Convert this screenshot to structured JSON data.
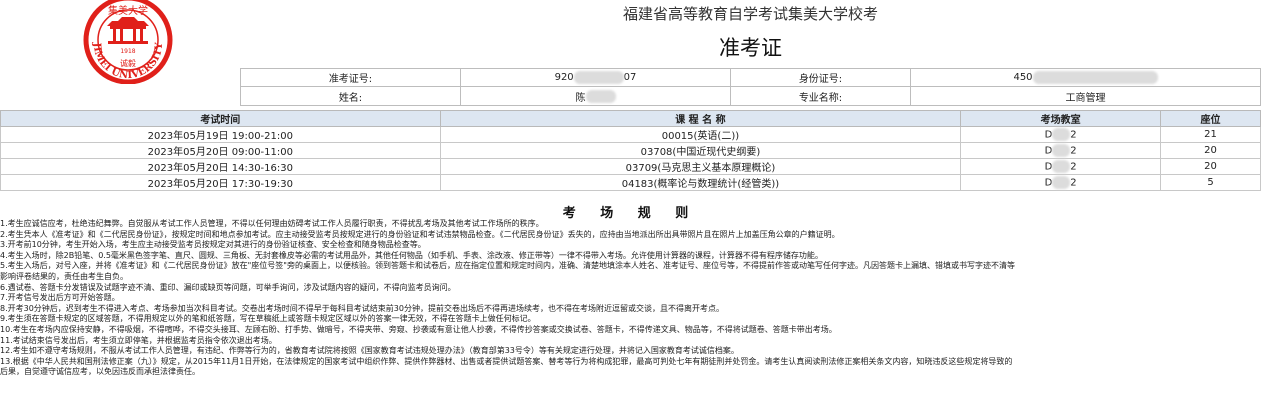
{
  "header": {
    "title": "福建省高等教育自学考试集美大学校考",
    "subtitle": "准考证"
  },
  "logo": {
    "arc_text": "JIMEI UNIVERSITY",
    "year": "1918",
    "seal_chars": "诚毅",
    "top_chars": "集美大学",
    "color": "#e0201a"
  },
  "info": {
    "ticket_label": "准考证号:",
    "ticket_start": "920",
    "ticket_end": "07",
    "id_label": "身份证号:",
    "id_start": "450",
    "name_label": "姓名:",
    "name_start": "陈",
    "major_label": "专业名称:",
    "major_value": "工商管理"
  },
  "exam_table": {
    "headers": [
      "考试时间",
      "课 程 名 称",
      "考场教室",
      "座位"
    ],
    "rows": [
      {
        "time": "2023年05月19日 19:00-21:00",
        "course": "00015(英语(二))",
        "room_start": "D",
        "room_end": "2",
        "seat": "21"
      },
      {
        "time": "2023年05月20日 09:00-11:00",
        "course": "03708(中国近现代史纲要)",
        "room_start": "D",
        "room_end": "2",
        "seat": "20"
      },
      {
        "time": "2023年05月20日 14:30-16:30",
        "course": "03709(马克思主义基本原理概论)",
        "room_start": "D",
        "room_end": "2",
        "seat": "20"
      },
      {
        "time": "2023年05月20日 17:30-19:30",
        "course": "04183(概率论与数理统计(经管类))",
        "room_start": "D",
        "room_end": "2",
        "seat": "5"
      }
    ]
  },
  "rules": {
    "title": "考 场 规 则",
    "items": [
      "1.考生应诚信应考，杜绝违纪舞弊。自觉服从考试工作人员管理，不得以任何理由妨碍考试工作人员履行职责，不得扰乱考场及其他考试工作场所的秩序。",
      "2.考生凭本人《准考证》和《二代居民身份证》，按规定时间和地点参加考试。应主动接受监考员按规定进行的身份验证和考试违禁物品检查。《二代居民身份证》丢失的，应持由当地派出所出具带照片且在照片上加盖压角公章的户籍证明。",
      "3.开考前10分钟，考生开始入场，考生应主动接受监考员按规定对其进行的身份验证核查、安全检查和随身物品检查等。",
      "4.考生入场时，除2B铅笔、0.5毫米黑色签字笔、直尺、圆规、三角板、无封套橡皮等必需的考试用品外，其他任何物品（如手机、手表、涂改液、修正带等）一律不得带入考场。允许使用计算器的课程，计算器不得有程序储存功能。",
      "5.考生入场后，对号入座，并将《准考证》和《二代居民身份证》放在\"座位号签\"旁的桌面上，以便核验。领到答题卡和试卷后，应在指定位置和规定时间内，准确、清楚地填涂本人姓名、准考证号、座位号等，不得提前作答或动笔写任何字迹。凡因答题卡上漏填、错填或书写字迹不清等",
      "影响评卷结果的，责任由考生自负。",
      "6.遇试卷、答题卡分发错误及试题字迹不清、重印、漏印或缺页等问题，可举手询问，涉及试题内容的疑问，不得向监考员询问。",
      "7.开考信号发出后方可开始答题。",
      "8.开考30分钟后，迟到考生不得进入考点、考场参加当次科目考试。交卷出考场时间不得早于每科目考试结束前30分钟，提前交卷出场后不得再进场续考，也不得在考场附近逗留或交谈，且不得离开考点。",
      "9.考生须在答题卡规定的区域答题，不得用规定以外的笔和纸答题，写在草稿纸上或答题卡规定区域以外的答案一律无效，不得在答题卡上做任何标记。",
      "10.考生在考场内应保持安静，不得吸烟，不得喧哗，不得交头接耳、左顾右盼、打手势、做暗号，不得夹带、旁窥、抄袭或有意让他人抄袭，不得传抄答案或交换试卷、答题卡，不得传递文具、物品等，不得将试题卷、答题卡带出考场。",
      "11.考试结束信号发出后，考生须立即停笔，并根据监考员指令依次退出考场。",
      "12.考生如不遵守考场规则，不服从考试工作人员管理，有违纪、作弊等行为的，省教育考试院将按照《国家教育考试违规处理办法》（教育部第33号令）等有关规定进行处理，并将记入国家教育考试诚信档案。",
      "13.根据《中华人民共和国刑法修正案（九）》规定，从2015年11月1日开始，在法律规定的国家考试中组织作弊、提供作弊器材、出售或者提供试题答案、替考等行为将构成犯罪，最高可判处七年有期徒刑并处罚金。请考生认真阅读刑法修正案相关条文内容，知晓违反这些规定将导致的",
      "后果，自觉遵守诚信应考，以免因违反而承担法律责任。"
    ]
  }
}
